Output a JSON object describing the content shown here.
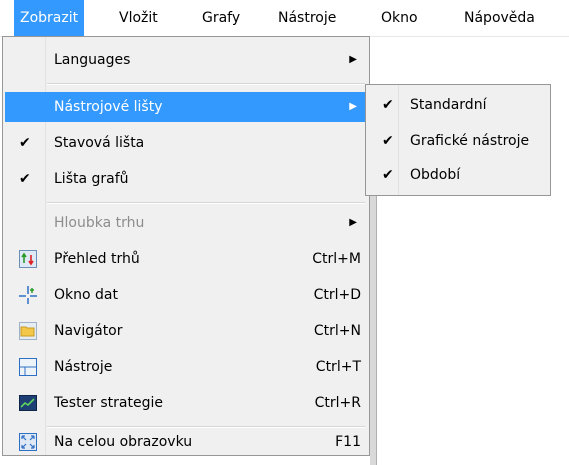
{
  "menubar": {
    "items": [
      {
        "label": "Zobrazit"
      },
      {
        "label": "Vložit"
      },
      {
        "label": "Grafy"
      },
      {
        "label": "Nástroje"
      },
      {
        "label": "Okno"
      },
      {
        "label": "Nápověda"
      }
    ],
    "active_index": 0
  },
  "view_menu": {
    "languages": {
      "label": "Languages"
    },
    "toolbars": {
      "label": "Nástrojové lišty"
    },
    "status_bar": {
      "label": "Stavová lišta",
      "checked": true
    },
    "charts_bar": {
      "label": "Lišta grafů",
      "checked": true
    },
    "market_depth": {
      "label": "Hloubka trhu",
      "disabled": true
    },
    "market_watch": {
      "label": "Přehled trhů",
      "shortcut": "Ctrl+M",
      "icon": "market-watch-icon"
    },
    "data_window": {
      "label": "Okno dat",
      "shortcut": "Ctrl+D",
      "icon": "data-window-icon"
    },
    "navigator": {
      "label": "Navigátor",
      "shortcut": "Ctrl+N",
      "icon": "navigator-folder-icon"
    },
    "tools": {
      "label": "Nástroje",
      "shortcut": "Ctrl+T",
      "icon": "tools-panel-icon"
    },
    "strategy_tester": {
      "label": "Tester strategie",
      "shortcut": "Ctrl+R",
      "icon": "strategy-tester-icon"
    },
    "fullscreen": {
      "label": "Na celou obrazovku",
      "shortcut": "F11",
      "icon": "fullscreen-icon"
    }
  },
  "toolbars_submenu": {
    "items": [
      {
        "label": "Standardní",
        "checked": true
      },
      {
        "label": "Grafické nástroje",
        "checked": true
      },
      {
        "label": "Období",
        "checked": true
      }
    ]
  },
  "colors": {
    "highlight": "#3399ff",
    "menu_bg": "#f0f0f0",
    "disabled_text": "#8d8d8d"
  }
}
